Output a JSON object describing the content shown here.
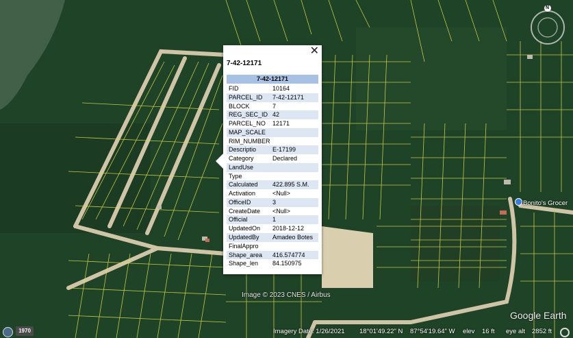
{
  "map": {
    "attribution": "Image © 2023 CNES / Airbus",
    "place_label": "Bonito's Grocer",
    "colors": {
      "parcel_line": "#e8e84a",
      "road": "#cfc4a6",
      "forest": "#1e4427",
      "water": "#3f5e47"
    }
  },
  "popup": {
    "title": "7-42-12171",
    "header": "7-42-12171",
    "rows": [
      {
        "k": "FID",
        "v": "10164"
      },
      {
        "k": "PARCEL_ID",
        "v": "7-42-12171"
      },
      {
        "k": "BLOCK",
        "v": "7"
      },
      {
        "k": "REG_SEC_ID",
        "v": "42"
      },
      {
        "k": "PARCEL_NO",
        "v": "12171"
      },
      {
        "k": "MAP_SCALE",
        "v": ""
      },
      {
        "k": "RIM_NUMBER",
        "v": ""
      },
      {
        "k": "Descriptio",
        "v": "E-17199"
      },
      {
        "k": "Category",
        "v": "Declared"
      },
      {
        "k": "LandUse",
        "v": ""
      },
      {
        "k": "Type",
        "v": ""
      },
      {
        "k": "Calculated",
        "v": "422.895 S.M."
      },
      {
        "k": "Activation",
        "v": "<Null>"
      },
      {
        "k": "OfficeID",
        "v": "3"
      },
      {
        "k": "CreateDate",
        "v": "<Null>"
      },
      {
        "k": "Official",
        "v": "1"
      },
      {
        "k": "UpdatedOn",
        "v": "2018-12-12"
      },
      {
        "k": "UpdatedBy",
        "v": "Amadeo Botes"
      },
      {
        "k": "FinalAppro",
        "v": ""
      },
      {
        "k": "Shape_area",
        "v": "416.574774"
      },
      {
        "k": "Shape_len",
        "v": "84.150975"
      }
    ]
  },
  "status": {
    "year": "1970",
    "imagery_date": "Imagery Date: 1/26/2021",
    "lat": "18°01'49.22\" N",
    "lon": "87°54'19.64\" W",
    "elev_label": "elev",
    "elev_value": "16 ft",
    "eye_alt_label": "eye alt",
    "eye_alt_value": "2852 ft"
  },
  "compass": {
    "north_label": "N"
  },
  "logo": "Google Earth"
}
